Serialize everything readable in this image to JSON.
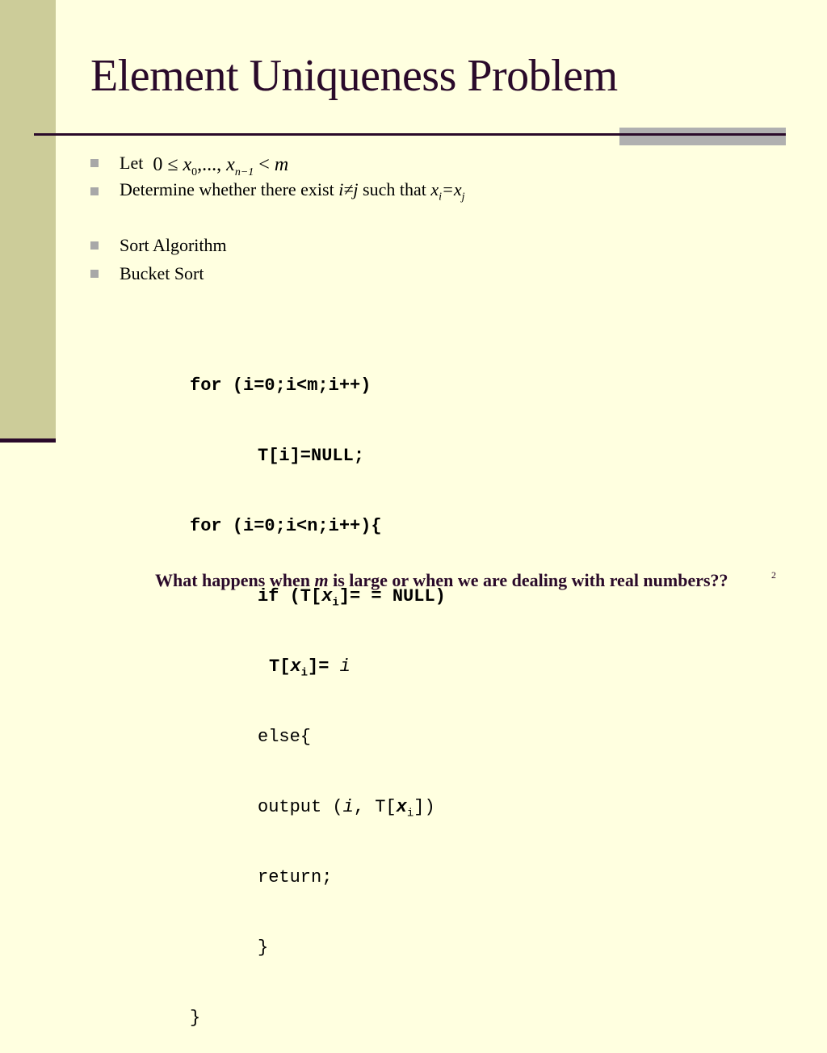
{
  "slide": {
    "title": "Element Uniqueness Problem",
    "slide_number": "2",
    "colors": {
      "background": "#ffffe0",
      "sidebar": "#cccc99",
      "accent_dark": "#2a0a2a",
      "bullet_gray": "#a8a8a8"
    },
    "bullets": [
      {
        "label": "Let",
        "formula": {
          "lhs": "0 ≤ ",
          "x": "x",
          "sub0": "0",
          "mid": ",..., ",
          "x2": "x",
          "sub1": "n−1",
          "rel": " < ",
          "m": "m"
        }
      },
      {
        "pre": "Determine whether there exist ",
        "ineq": "i≠j",
        "mid": " such that ",
        "x1": "x",
        "s1": "i",
        "eq": "=",
        "x2": "x",
        "s2": "j"
      },
      {
        "label": "Sort Algorithm"
      },
      {
        "label": "Bucket Sort"
      }
    ],
    "code": {
      "l1": "for (i=0;i<m;i++)",
      "l2": "T[i]=NULL;",
      "l3": "for (i=0;i<n;i++){",
      "l4a": "if (T[",
      "l4x": "x",
      "l4s": "i",
      "l4b": "]= = NULL)",
      "l5a": "T[",
      "l5x": "x",
      "l5s": "i",
      "l5b": "]= ",
      "l5i": "i",
      "l6": "else{",
      "l7a": "output (",
      "l7i": "i",
      "l7b": ", T[",
      "l7x": "x",
      "l7s": "i",
      "l7c": "])",
      "l8": "return;",
      "l9": "}",
      "l10": "}"
    },
    "question": {
      "pre": "What happens when ",
      "m": "m",
      "post": " is large or when we are dealing with real numbers??"
    }
  }
}
